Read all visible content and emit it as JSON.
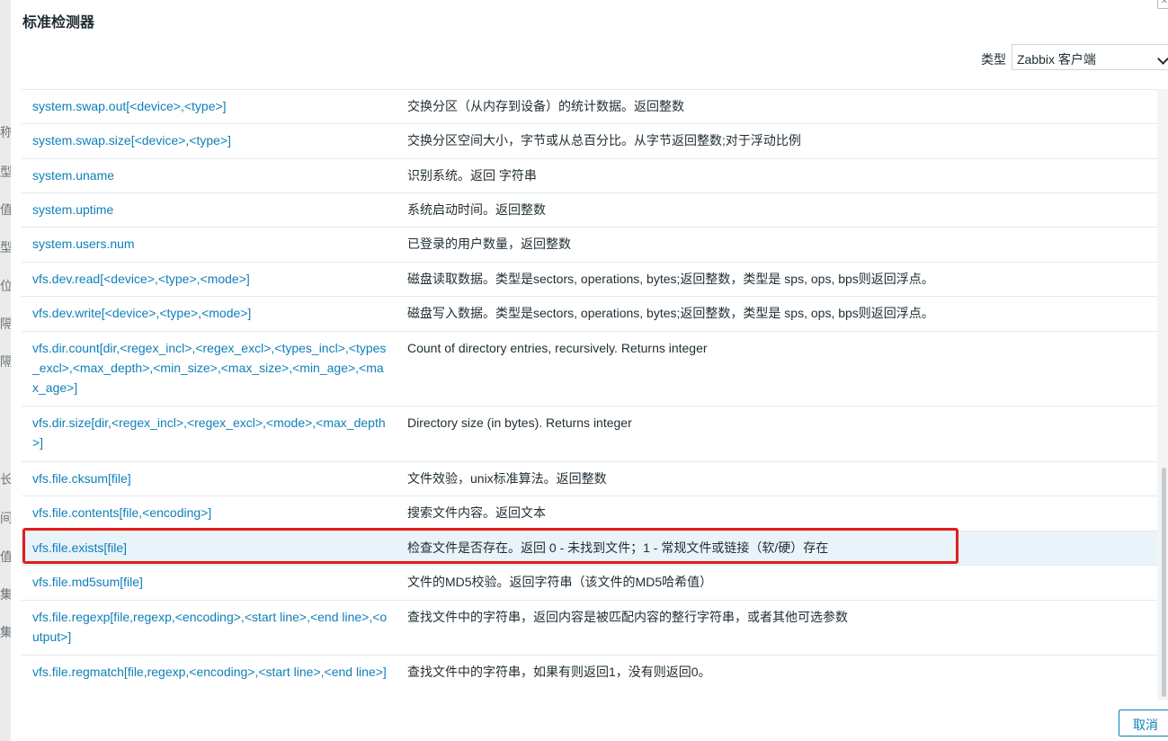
{
  "dialog": {
    "title": "标准检测器",
    "type_label": "类型",
    "type_value": "Zabbix 客户端",
    "cancel_label": "取消"
  },
  "background_labels": [
    "称",
    "型",
    "值",
    "型",
    "位",
    "隔",
    "隔",
    "长",
    "间",
    "值",
    "集",
    "集"
  ],
  "rows": [
    {
      "key": "system.swap.out[<device>,<type>]",
      "desc": "交换分区（从内存到设备）的统计数据。返回整数"
    },
    {
      "key": "system.swap.size[<device>,<type>]",
      "desc": "交换分区空间大小，字节或从总百分比。从字节返回整数;对于浮动比例"
    },
    {
      "key": "system.uname",
      "desc": "识别系统。返回 字符串"
    },
    {
      "key": "system.uptime",
      "desc": "系统启动时间。返回整数"
    },
    {
      "key": "system.users.num",
      "desc": "已登录的用户数量，返回整数"
    },
    {
      "key": "vfs.dev.read[<device>,<type>,<mode>]",
      "desc": "磁盘读取数据。类型是sectors, operations, bytes;返回整数，类型是 sps, ops, bps则返回浮点。"
    },
    {
      "key": "vfs.dev.write[<device>,<type>,<mode>]",
      "desc": "磁盘写入数据。类型是sectors, operations, bytes;返回整数，类型是 sps, ops, bps则返回浮点。"
    },
    {
      "key": "vfs.dir.count[dir,<regex_incl>,<regex_excl>,<types_incl>,<types_excl>,<max_depth>,<min_size>,<max_size>,<min_age>,<max_age>]",
      "desc": "Count of directory entries, recursively. Returns integer"
    },
    {
      "key": "vfs.dir.size[dir,<regex_incl>,<regex_excl>,<mode>,<max_depth>]",
      "desc": "Directory size (in bytes). Returns integer"
    },
    {
      "key": "vfs.file.cksum[file]",
      "desc": "文件效验，unix标准算法。返回整数"
    },
    {
      "key": "vfs.file.contents[file,<encoding>]",
      "desc": "搜索文件内容。返回文本"
    },
    {
      "key": "vfs.file.exists[file]",
      "desc": "检查文件是否存在。返回 0 - 未找到文件；1 - 常规文件或链接（软/硬）存在"
    },
    {
      "key": "vfs.file.md5sum[file]",
      "desc": "文件的MD5校验。返回字符串（该文件的MD5哈希值）"
    },
    {
      "key": "vfs.file.regexp[file,regexp,<encoding>,<start line>,<end line>,<output>]",
      "desc": "查找文件中的字符串，返回内容是被匹配内容的整行字符串，或者其他可选参数"
    },
    {
      "key": "vfs.file.regmatch[file,regexp,<encoding>,<start line>,<end line>]",
      "desc": "查找文件中的字符串，如果有则返回1，没有则返回0。"
    }
  ]
}
